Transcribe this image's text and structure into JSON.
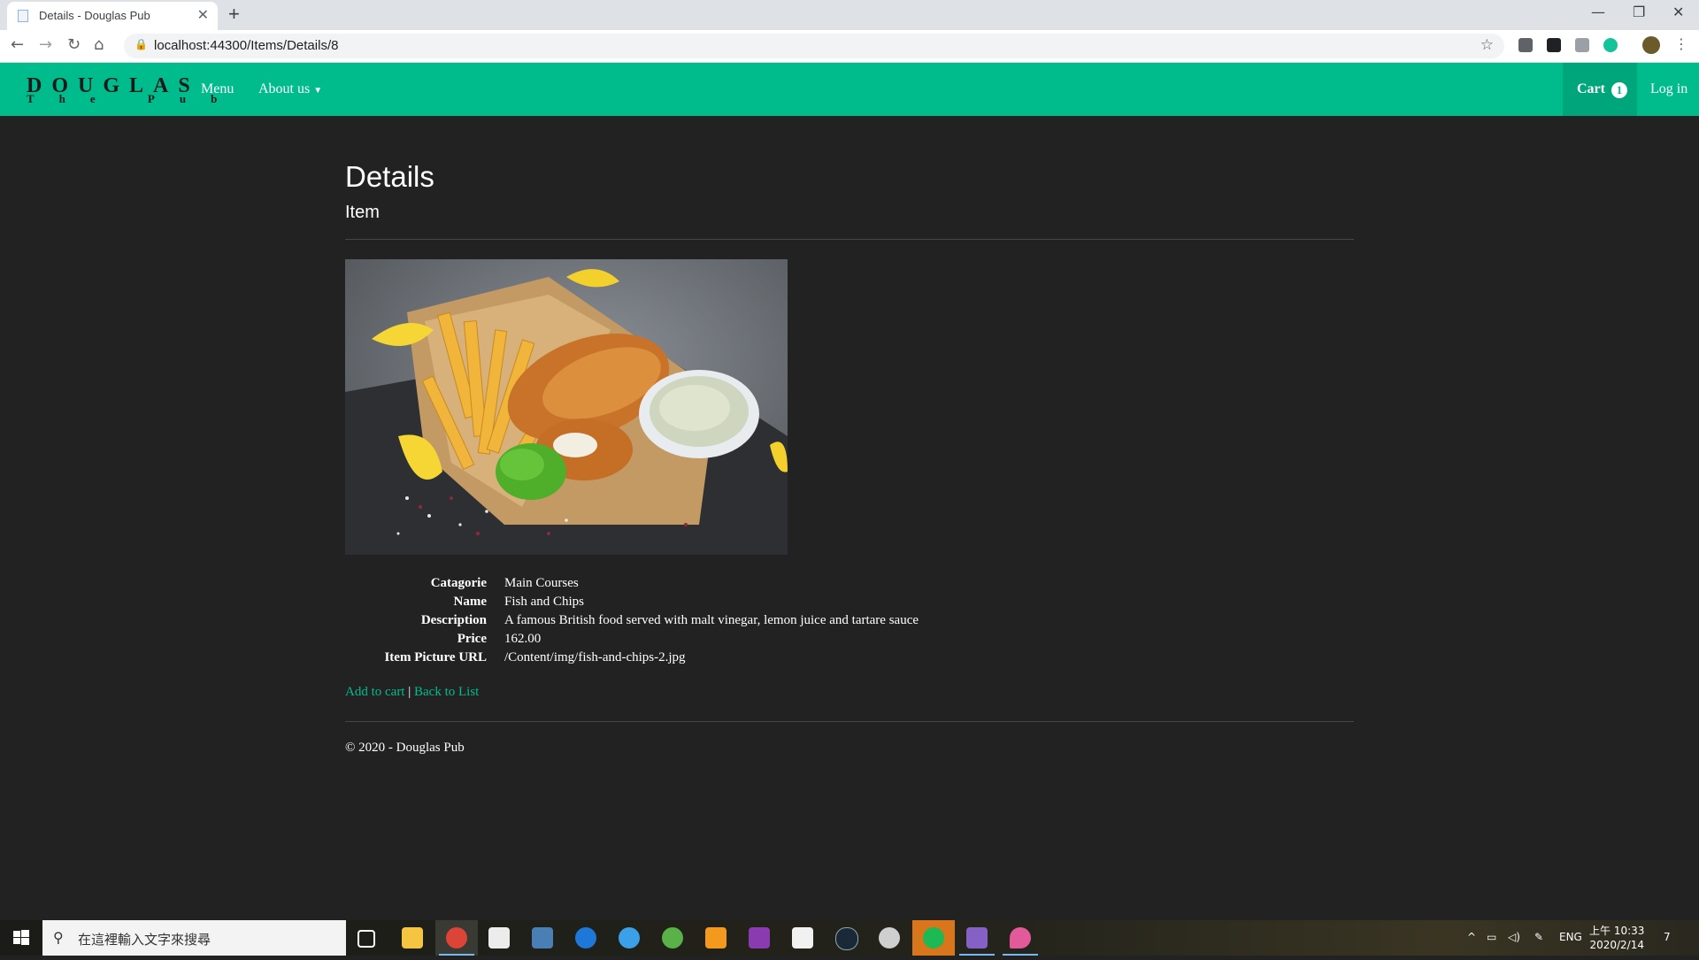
{
  "browser": {
    "tab_title": "Details - Douglas Pub",
    "tab_close": "✕",
    "new_tab": "+",
    "url": "localhost:44300/Items/Details/8",
    "window_controls": [
      "—",
      "❐",
      "✕"
    ],
    "nav_icons": [
      "back-icon",
      "forward-icon",
      "reload-icon",
      "home-icon"
    ]
  },
  "site": {
    "brand_top": "DOUGLAS",
    "brand_bottom": "The Pub",
    "nav": {
      "menu": "Menu",
      "about": "About us",
      "cart": "Cart",
      "cart_count": "1",
      "login": "Log in"
    },
    "accent_color": "#00bc8c",
    "background_color": "#222222"
  },
  "page": {
    "title": "Details",
    "subtitle": "Item",
    "fields": [
      {
        "label": "Catagorie",
        "value": "Main Courses"
      },
      {
        "label": "Name",
        "value": "Fish and Chips"
      },
      {
        "label": "Description",
        "value": "A famous British food served with malt vinegar, lemon juice and tartare sauce"
      },
      {
        "label": "Price",
        "value": "162.00"
      },
      {
        "label": "Item Picture URL",
        "value": "/Content/img/fish-and-chips-2.jpg"
      }
    ],
    "add_to_cart": "Add to cart",
    "separator": "|",
    "back_to_list": "Back to List",
    "footer": "© 2020 - Douglas Pub"
  },
  "taskbar": {
    "search_placeholder": "在這裡輸入文字來搜尋",
    "lang": "ENG",
    "time": "上午 10:33",
    "date": "2020/2/14",
    "notifications": "7"
  }
}
